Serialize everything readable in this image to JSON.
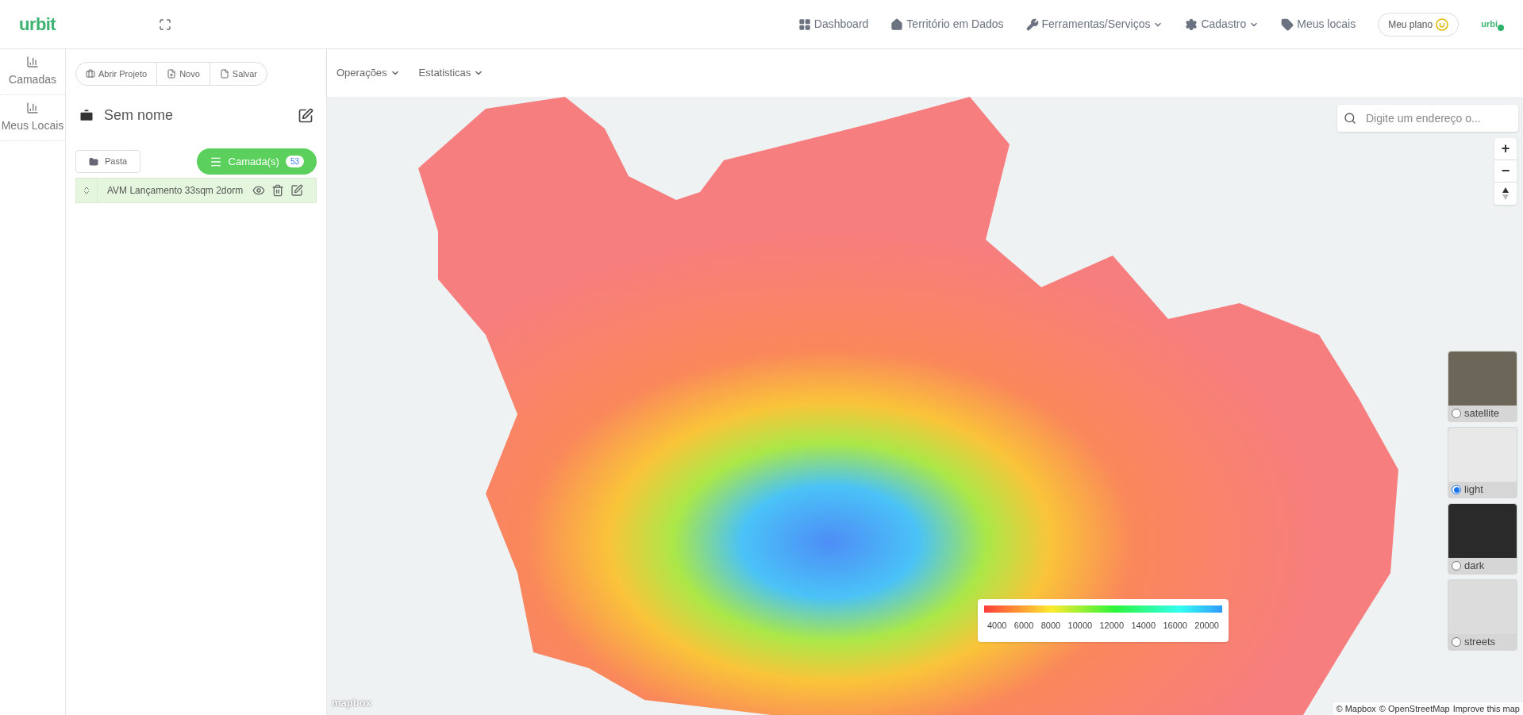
{
  "header": {
    "logo": "urbit",
    "nav": [
      {
        "kind": "grid",
        "label": "Dashboard",
        "caret": false
      },
      {
        "kind": "home",
        "label": "Território em Dados",
        "caret": false
      },
      {
        "kind": "wrench",
        "label": "Ferramentas/Serviços",
        "caret": true
      },
      {
        "kind": "gear",
        "label": "Cadastro",
        "caret": true
      },
      {
        "kind": "tag",
        "label": "Meus locais",
        "caret": false
      }
    ],
    "plan_button": "Meu plano",
    "user_badge": "urbi"
  },
  "side_nav": [
    {
      "label": "Camadas"
    },
    {
      "label": "Meus Locais"
    }
  ],
  "project": {
    "actions": [
      {
        "kind": "briefcase",
        "label": "Abrir Projeto"
      },
      {
        "kind": "file-plus",
        "label": "Novo"
      },
      {
        "kind": "file",
        "label": "Salvar"
      }
    ],
    "name": "Sem nome",
    "folder_button": "Pasta",
    "layers_button": "Camada(s)",
    "layers_count": "53",
    "layers": [
      {
        "name": "AVM Lançamento 33sqm 2dorm"
      }
    ]
  },
  "map_toolbar": [
    "Operações",
    "Estatisticas"
  ],
  "map": {
    "search": {
      "placeholder": "Digite um endereço o..."
    },
    "zoom_in": "+",
    "zoom_out": "−",
    "legend": {
      "ticks": [
        "4000",
        "6000",
        "8000",
        "10000",
        "12000",
        "14000",
        "16000",
        "20000"
      ]
    },
    "styles": [
      {
        "kind": "satellite",
        "label": "satellite",
        "selected": false
      },
      {
        "kind": "light",
        "label": "light",
        "selected": true
      },
      {
        "kind": "dark",
        "label": "dark",
        "selected": false
      },
      {
        "kind": "streets",
        "label": "streets",
        "selected": false
      }
    ],
    "logo": "mapbox",
    "attribution": [
      "© Mapbox",
      "© OpenStreetMap",
      "Improve this map"
    ]
  }
}
